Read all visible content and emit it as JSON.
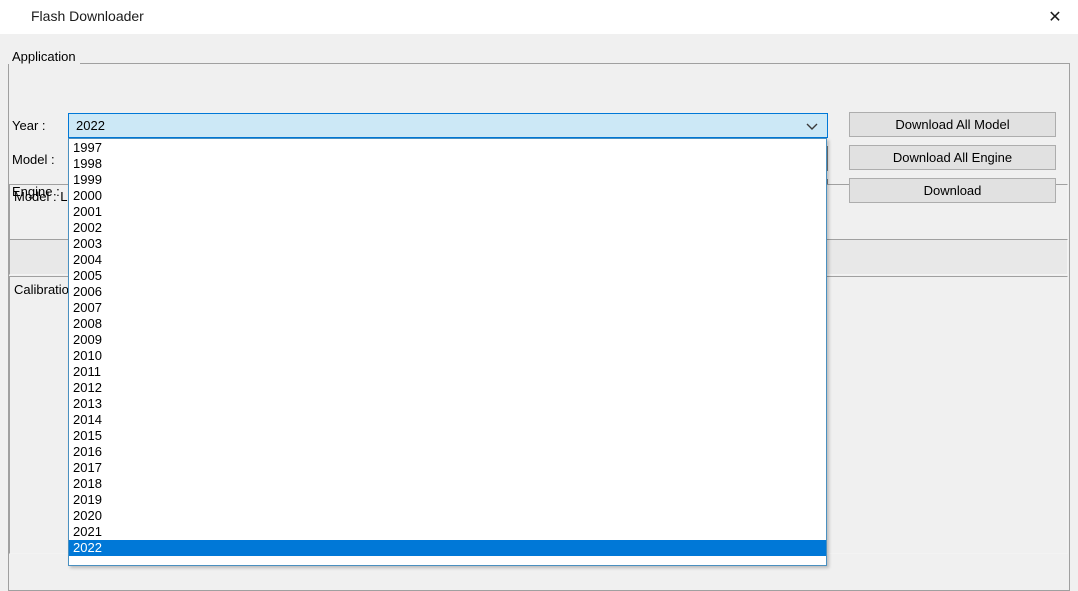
{
  "window": {
    "title": "Flash Downloader",
    "close_label": "✕"
  },
  "group": {
    "legend": "Application"
  },
  "fields": {
    "year_label": "Year :",
    "model_label": "Model :",
    "engine_label": "Engine :",
    "year_value": "2022",
    "model_value": "",
    "engine_value": "",
    "dropdown_arrow_icon": "chevron-down-icon"
  },
  "buttons": {
    "download_all_model": "Download All Model",
    "download_all_engine": "Download All Engine",
    "download": "Download"
  },
  "panels": {
    "model_label": "Model : L",
    "status_text": "",
    "calibration_label": "Calibration"
  },
  "dropdown": {
    "selected": "2022",
    "options": [
      "1997",
      "1998",
      "1999",
      "2000",
      "2001",
      "2002",
      "2003",
      "2004",
      "2005",
      "2006",
      "2007",
      "2008",
      "2009",
      "2010",
      "2011",
      "2012",
      "2013",
      "2014",
      "2015",
      "2016",
      "2017",
      "2018",
      "2019",
      "2020",
      "2021",
      "2022"
    ]
  },
  "colors": {
    "accent": "#0078d7",
    "combo_focus_fill": "#cce8f6",
    "window_bg": "#f0f0f0",
    "button_bg": "#e1e1e1"
  }
}
